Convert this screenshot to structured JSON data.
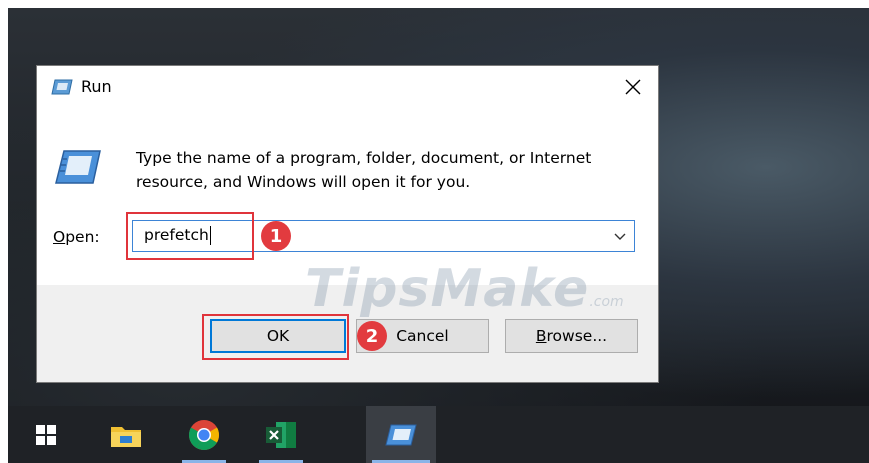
{
  "dialog": {
    "title": "Run",
    "description": "Type the name of a program, folder, document, or Internet resource, and Windows will open it for you.",
    "open_label_prefix": "O",
    "open_label_rest": "pen:",
    "input_value": "prefetch",
    "ok_label": "OK",
    "cancel_label": "Cancel",
    "browse_label_prefix": "B",
    "browse_label_rest": "rowse..."
  },
  "annotations": {
    "step1": "1",
    "step2": "2"
  },
  "watermark": {
    "text": "TipsMake",
    "suffix": ".com"
  },
  "taskbar": {
    "items": [
      "start-icon",
      "file-explorer-icon",
      "chrome-icon",
      "excel-icon",
      "run-app-icon"
    ]
  },
  "colors": {
    "highlight": "#e0343b",
    "step_badge": "#e23b3f",
    "focus_border": "#0078d7"
  }
}
